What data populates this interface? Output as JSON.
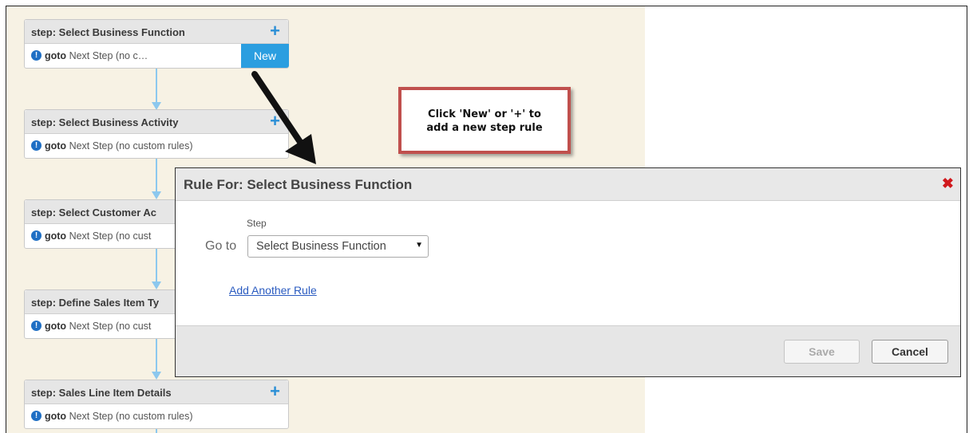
{
  "steps": [
    {
      "title": "step: Select Business Function",
      "goto": "goto",
      "rule": "Next Step (no c…",
      "new_label": "New",
      "plus": "+"
    },
    {
      "title": "step: Select Business Activity",
      "goto": "goto",
      "rule": "Next Step (no custom rules)",
      "plus": "+"
    },
    {
      "title": "step: Select Customer Ac",
      "goto": "goto",
      "rule": "Next Step (no cust"
    },
    {
      "title": "step: Define Sales Item Ty",
      "goto": "goto",
      "rule": "Next Step (no cust"
    },
    {
      "title": "step: Sales Line Item Details",
      "goto": "goto",
      "rule": "Next Step (no custom rules)",
      "plus": "+"
    }
  ],
  "callout": {
    "text": "Click 'New' or '+' to\nadd a new step rule"
  },
  "dialog": {
    "title": "Rule For: Select Business Function",
    "close_icon": "close-icon",
    "step_label": "Step",
    "goto_label": "Go to",
    "select_value": "Select Business Function",
    "add_rule_link": "Add Another Rule",
    "save_label": "Save",
    "cancel_label": "Cancel"
  },
  "colors": {
    "accent": "#2b9ee0",
    "canvas_bg": "#f7f2e4",
    "callout_border": "#c0504d",
    "close": "#d0191d"
  }
}
